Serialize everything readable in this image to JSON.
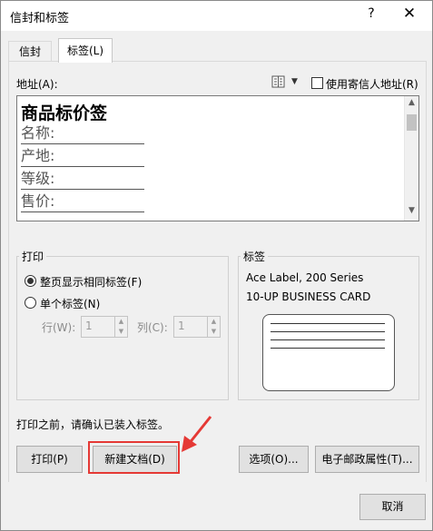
{
  "window": {
    "title": "信封和标签",
    "help": "?",
    "close": "✕"
  },
  "tabs": [
    {
      "label": "信封"
    },
    {
      "label": "标签(L)"
    }
  ],
  "address": {
    "label": "地址(A):",
    "book_icon": "address-book-icon",
    "use_return_label": "使用寄信人地址(R)",
    "use_return_checked": false,
    "content_title": "商品标价签",
    "lines": [
      "名称:",
      "产地:",
      "等级:",
      "售价:"
    ]
  },
  "print_group": {
    "title": "打印",
    "full_page_label": "整页显示相同标签(F)",
    "single_label": "单个标签(N)",
    "selected": "full_page",
    "row_label": "行(W):",
    "row_value": "1",
    "col_label": "列(C):",
    "col_value": "1"
  },
  "label_group": {
    "title": "标签",
    "line1": "Ace Label, 200 Series",
    "line2": "10-UP BUSINESS CARD"
  },
  "note": "打印之前，请确认已装入标签。",
  "buttons": {
    "print": "打印(P)",
    "new_doc": "新建文档(D)",
    "options": "选项(O)...",
    "postage": "电子邮政属性(T)...",
    "cancel": "取消"
  },
  "annotation": {
    "color": "#e53935"
  }
}
